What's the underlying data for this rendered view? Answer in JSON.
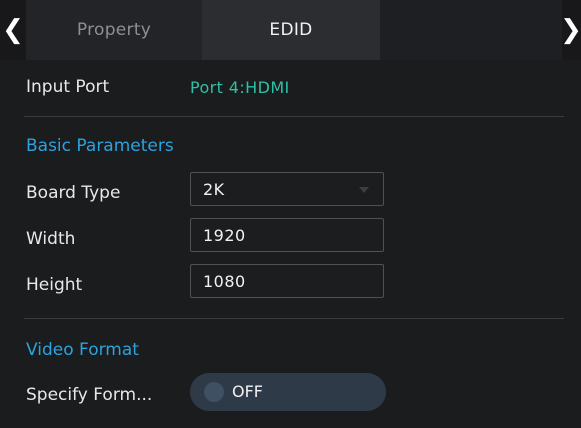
{
  "tabs": {
    "property_label": "Property",
    "edid_label": "EDID",
    "prev_arrow": "❮",
    "next_arrow": "❯"
  },
  "input_port": {
    "label": "Input Port",
    "value": "Port 4:HDMI"
  },
  "basic_parameters": {
    "title": "Basic Parameters",
    "board_type": {
      "label": "Board Type",
      "value": "2K"
    },
    "width": {
      "label": "Width",
      "value": "1920"
    },
    "height": {
      "label": "Height",
      "value": "1080"
    }
  },
  "video_format": {
    "title": "Video Format",
    "specify_format": {
      "label": "Specify Form...",
      "toggle_text": "OFF",
      "state": "off"
    }
  },
  "colors": {
    "accent_teal": "#2fc0a6",
    "section_blue": "#2aa3e0",
    "background": "#1b1c1e"
  }
}
